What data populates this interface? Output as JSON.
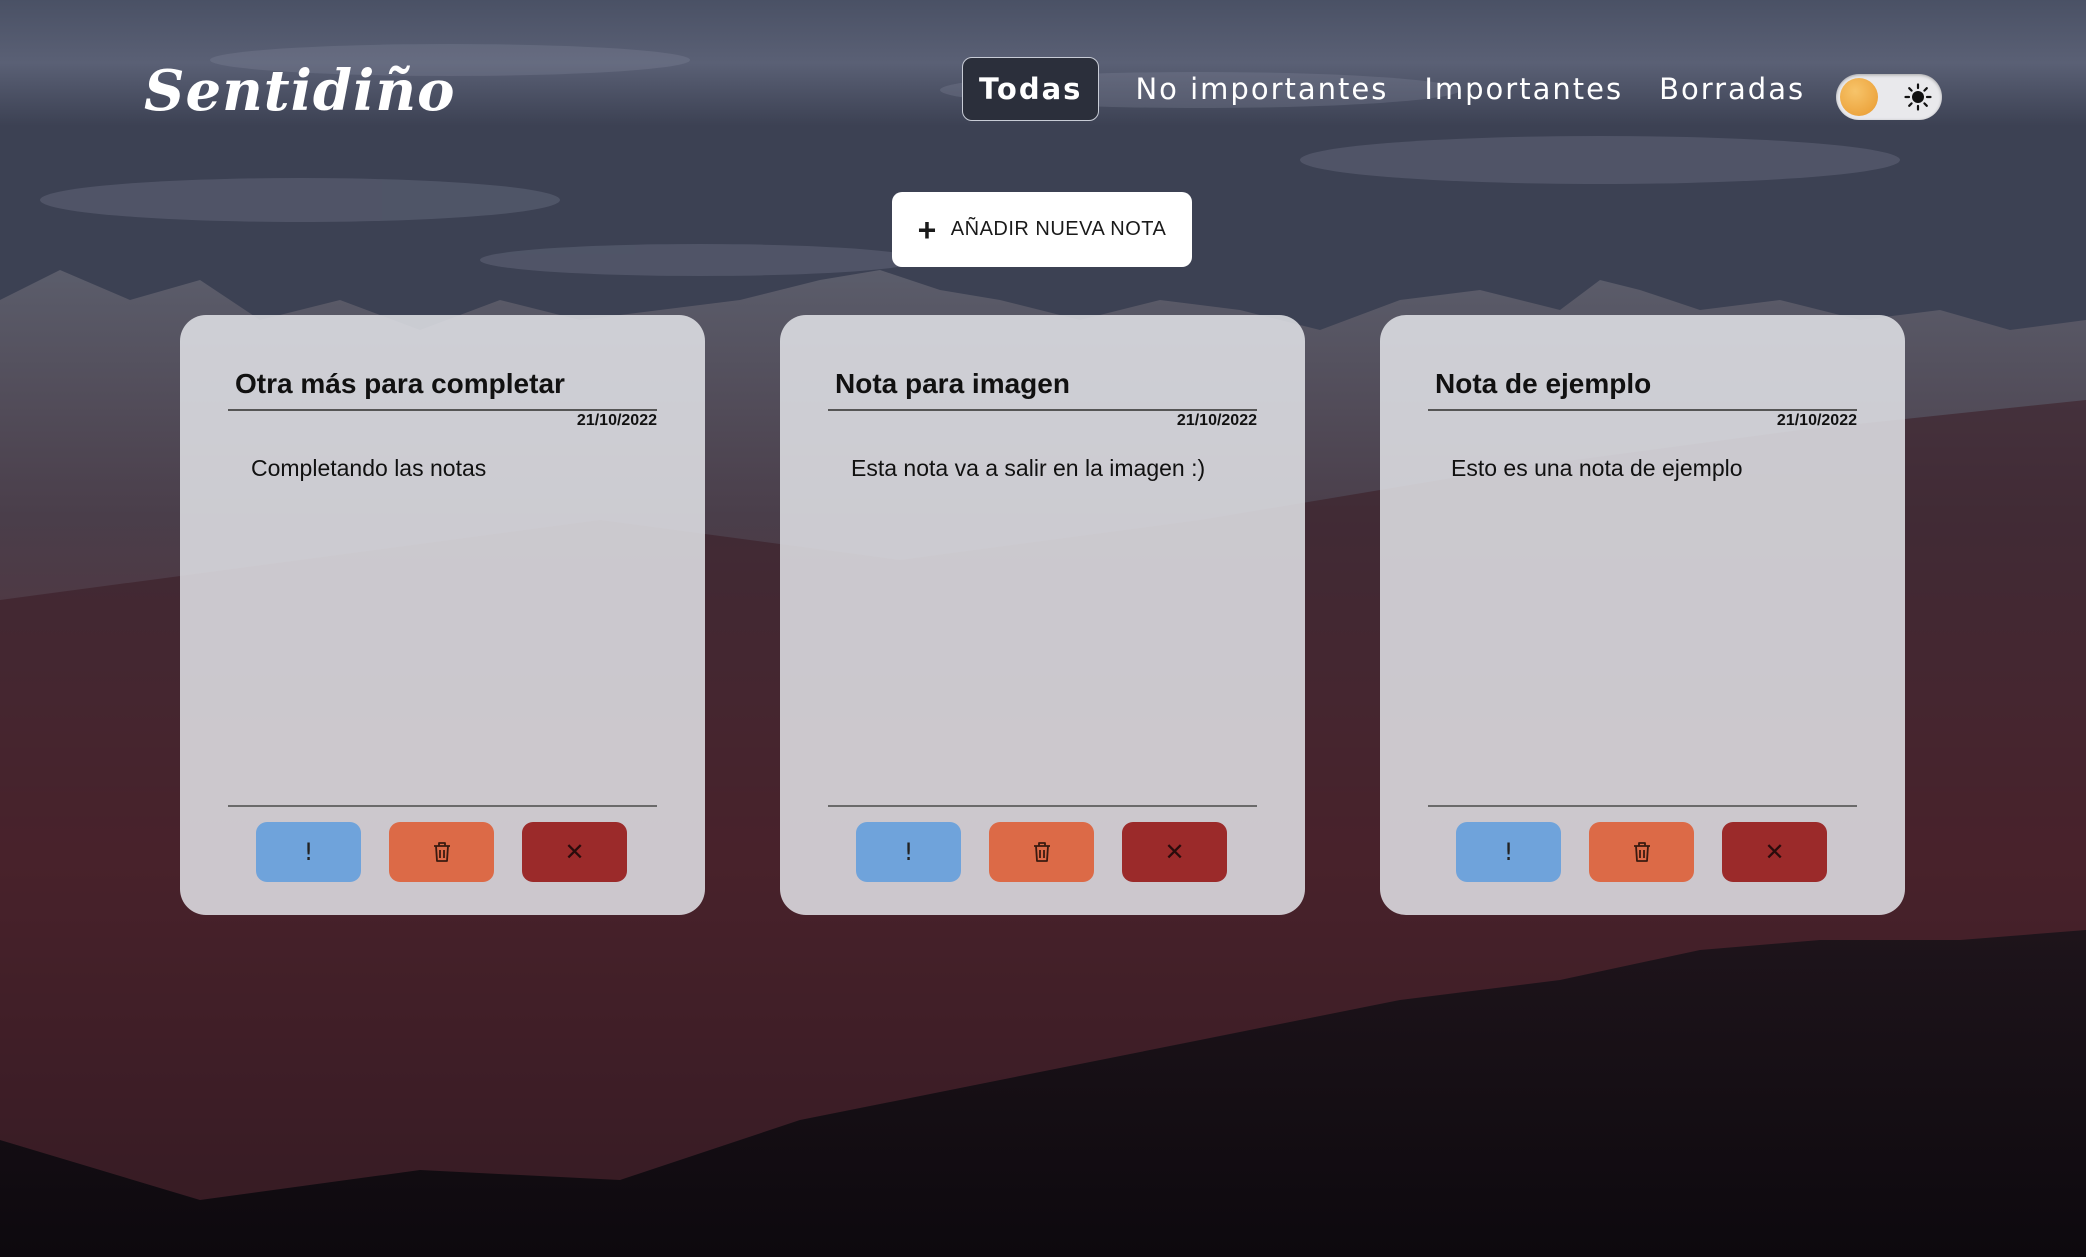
{
  "app": {
    "logo": "Sentidiño"
  },
  "nav": {
    "items": [
      {
        "label": "Todas",
        "active": true
      },
      {
        "label": "No importantes",
        "active": false
      },
      {
        "label": "Importantes",
        "active": false
      },
      {
        "label": "Borradas",
        "active": false
      }
    ]
  },
  "theme_toggle": {
    "state": "light",
    "knob_icon": "sun-circle-icon",
    "icon": "sun-icon"
  },
  "add_button": {
    "icon": "plus-icon",
    "label": "AÑADIR NUEVA NOTA"
  },
  "notes": [
    {
      "title": "Otra más para completar",
      "date": "21/10/2022",
      "body": "Completando las notas",
      "actions": {
        "important": "!",
        "delete_icon": "trash-icon",
        "remove": "✕"
      }
    },
    {
      "title": "Nota para imagen",
      "date": "21/10/2022",
      "body": "Esta nota va a salir en la imagen :)",
      "actions": {
        "important": "!",
        "delete_icon": "trash-icon",
        "remove": "✕"
      }
    },
    {
      "title": "Nota de ejemplo",
      "date": "21/10/2022",
      "body": "Esto es una nota de ejemplo",
      "actions": {
        "important": "!",
        "delete_icon": "trash-icon",
        "remove": "✕"
      }
    }
  ],
  "colors": {
    "important_button": "#6fa3db",
    "delete_button": "#dc6a47",
    "remove_button": "#9b2a2a",
    "card_background": "#e2e3e8",
    "active_nav": "#2b2f3b"
  }
}
